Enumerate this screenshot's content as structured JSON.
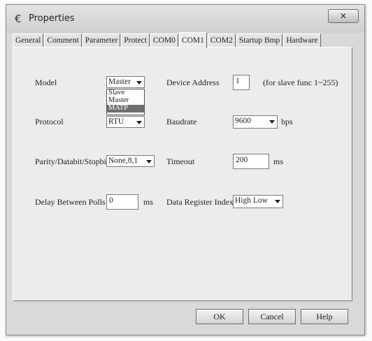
{
  "window": {
    "title": "Properties",
    "close_icon": "close-icon"
  },
  "tabs": [
    "General",
    "Comment",
    "Parameter",
    "Protect",
    "COM0",
    "COM1",
    "COM2",
    "Startup Bmp",
    "Hardware"
  ],
  "active_tab": "COM1",
  "form": {
    "model_label": "Model",
    "model_value": "Master",
    "model_options": [
      "Slave",
      "Master",
      "MATP"
    ],
    "model_highlighted": "MATP",
    "device_address_label": "Device Address",
    "device_address_value": "1",
    "device_address_hint": "(for slave func 1~255)",
    "protocol_label": "Protocol",
    "protocol_value": "RTU",
    "baudrate_label": "Baudrate",
    "baudrate_value": "9600",
    "baudrate_unit": "bps",
    "parity_label": "Parity/Databit/Stopbit",
    "parity_value": "None,8,1",
    "timeout_label": "Timeout",
    "timeout_value": "200",
    "timeout_unit": "ms",
    "delay_label": "Delay Between Polls",
    "delay_value": "0",
    "delay_unit": "ms",
    "data_register_label": "Data Register Index",
    "data_register_value": "High Low"
  },
  "buttons": {
    "ok": "OK",
    "cancel": "Cancel",
    "help": "Help"
  }
}
